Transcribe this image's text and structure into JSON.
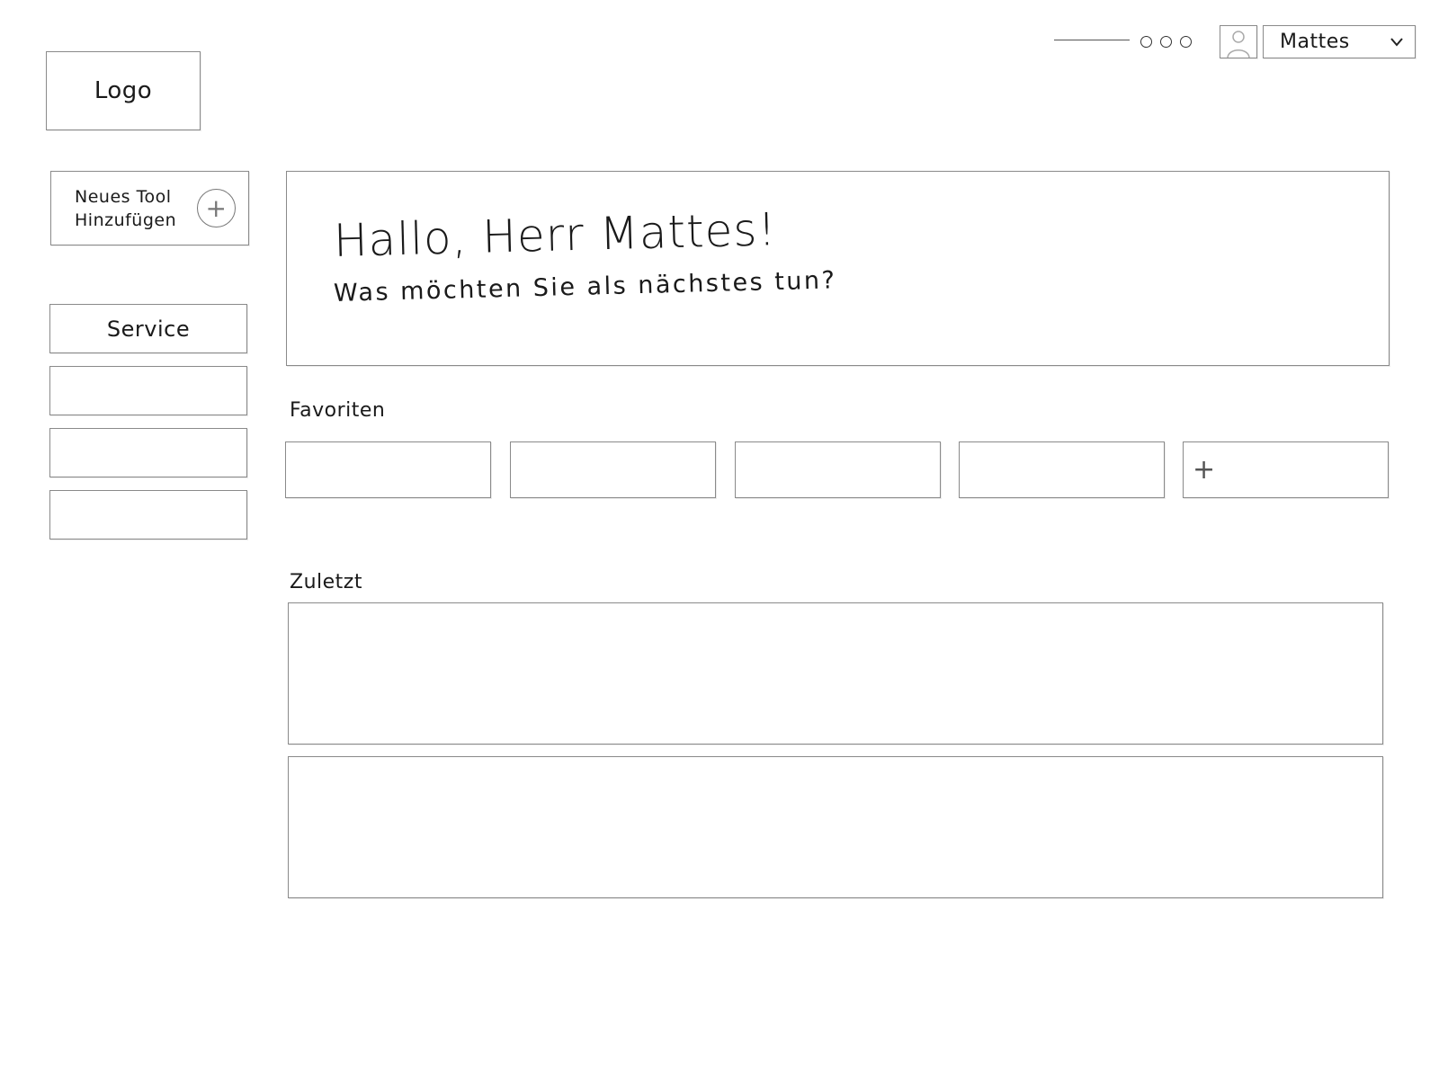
{
  "header": {
    "logo_text": "Logo",
    "user_name": "Mattes",
    "user_chevron": "⌄",
    "icons": {
      "avatar": "avatar-icon",
      "menu_dots": "dots-icon",
      "chevron": "chevron-down-icon"
    }
  },
  "sidebar": {
    "add_tool_label": "Neues Tool\nHinzufügen",
    "add_tool_icon": "+",
    "items": [
      {
        "label": "Service"
      },
      {
        "label": ""
      },
      {
        "label": ""
      },
      {
        "label": ""
      }
    ]
  },
  "greeting": {
    "title": "Hallo, Herr Mattes!",
    "subtitle": "Was möchten Sie als nächstes tun?"
  },
  "favorites": {
    "label": "Favoriten",
    "add_icon": "+"
  },
  "recent": {
    "label": "Zuletzt"
  }
}
